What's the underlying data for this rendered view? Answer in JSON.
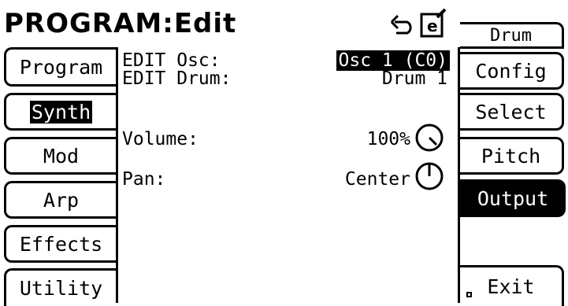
{
  "header": {
    "title": "PROGRAM:Edit",
    "icons": [
      "undo-icon",
      "edit-document-icon"
    ]
  },
  "left_tabs": [
    {
      "label": "Program",
      "selected": false
    },
    {
      "label": "Synth",
      "selected": true
    },
    {
      "label": "Mod",
      "selected": false
    },
    {
      "label": "Arp",
      "selected": false
    },
    {
      "label": "Effects",
      "selected": false
    },
    {
      "label": "Utility",
      "selected": false
    }
  ],
  "right_buttons": [
    {
      "label": "Drum",
      "active": false
    },
    {
      "label": "Config",
      "active": false
    },
    {
      "label": "Select",
      "active": false
    },
    {
      "label": "Pitch",
      "active": false
    },
    {
      "label": "Output",
      "active": true
    },
    {
      "label": "Exit",
      "active": false
    }
  ],
  "edit": {
    "osc_label": "EDIT Osc:",
    "osc_value": "Osc 1 (C0)",
    "drum_label": "EDIT Drum:",
    "drum_value": "Drum 1"
  },
  "params": {
    "volume_label": "Volume:",
    "volume_value": "100%",
    "pan_label": "Pan:",
    "pan_value": "Center"
  }
}
